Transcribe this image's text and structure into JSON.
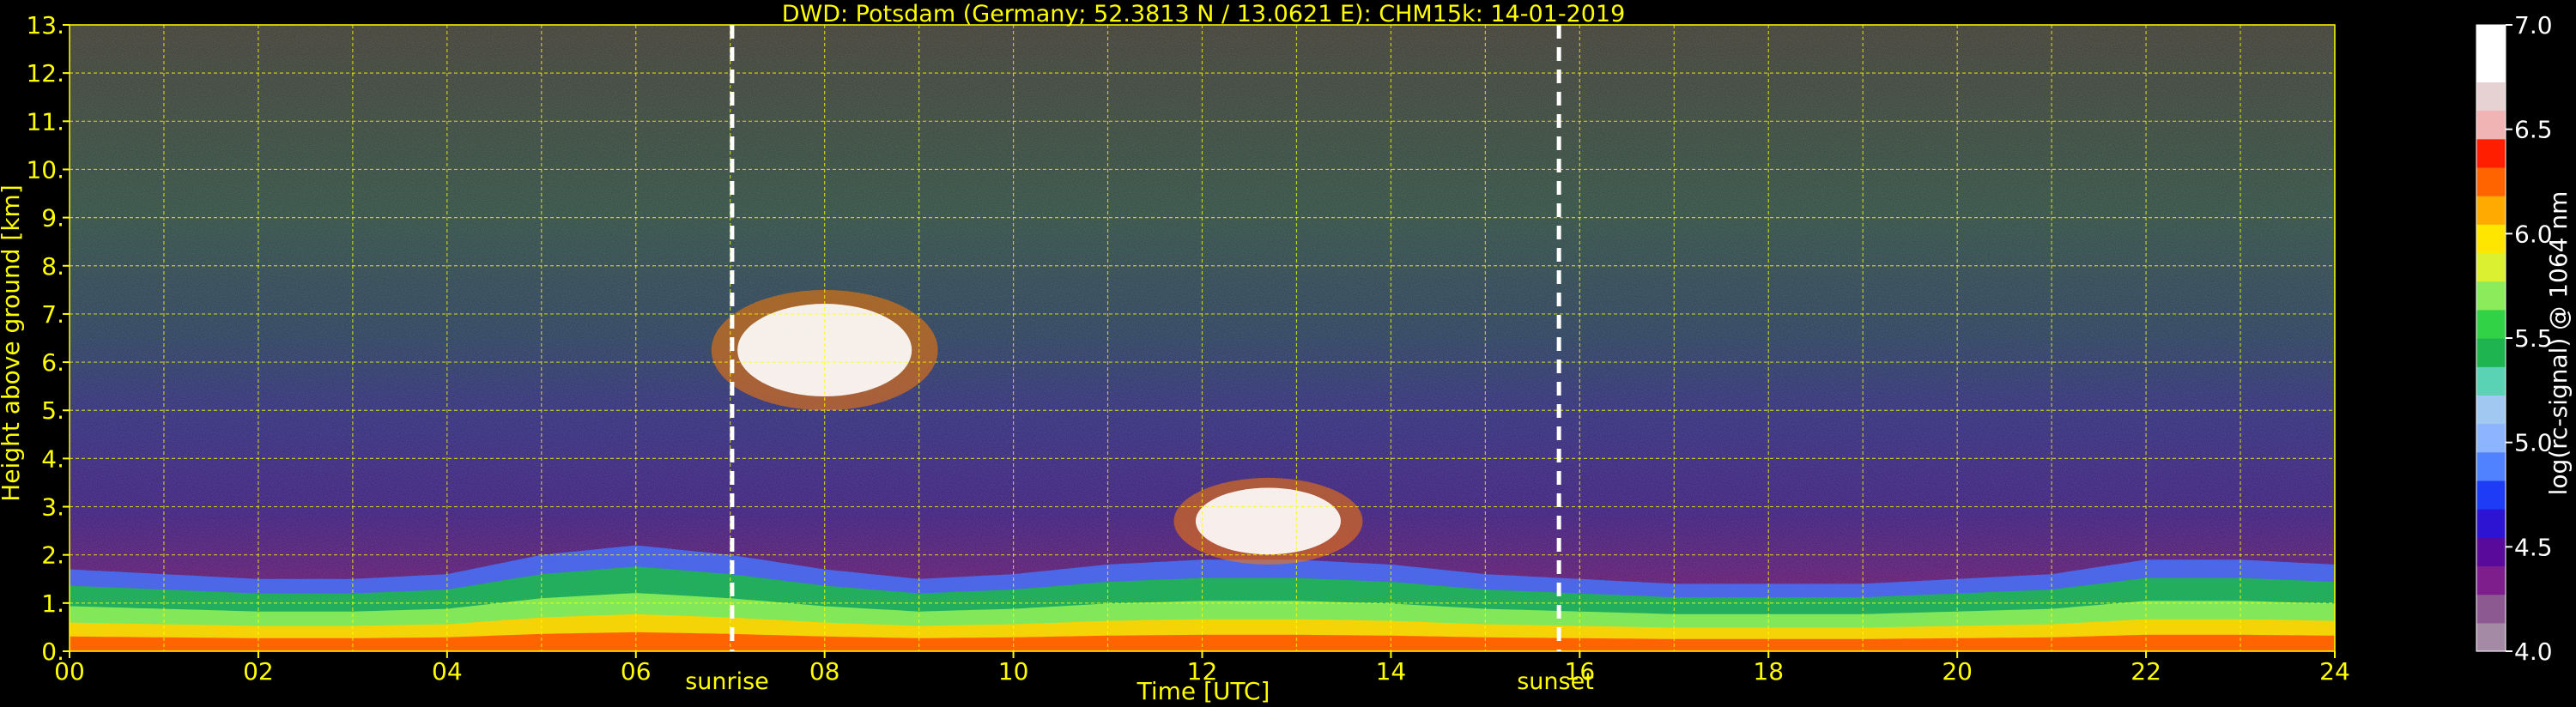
{
  "chart_data": {
    "type": "heatmap",
    "title": "DWD: Potsdam (Germany; 52.3813 N / 13.0621 E):    CHM15k: 14-01-2019",
    "xlabel": "Time [UTC]",
    "ylabel": "Height above ground [km]",
    "xlim": [
      0,
      24
    ],
    "ylim": [
      0,
      13
    ],
    "x_ticks": [
      "00",
      "02",
      "04",
      "06",
      "08",
      "10",
      "12",
      "14",
      "16",
      "18",
      "20",
      "22",
      "24"
    ],
    "y_ticks": [
      "0.",
      "1.",
      "2.",
      "3.",
      "4.",
      "5.",
      "6.",
      "7.",
      "8.",
      "9.",
      "10.",
      "11.",
      "12.",
      "13."
    ],
    "grid": true,
    "colorbar": {
      "label": "log(rc-signal) @ 1064 nm",
      "range": [
        4.0,
        7.0
      ],
      "ticks": [
        "4.0",
        "4.5",
        "5.0",
        "5.5",
        "6.0",
        "6.5",
        "7.0"
      ],
      "colors": [
        "#a58aa5",
        "#8c5a91",
        "#7d1e8c",
        "#5a0a9b",
        "#2d14d2",
        "#1e3cf5",
        "#5082ff",
        "#8cb4ff",
        "#a0c8f0",
        "#5ad2b4",
        "#1eb450",
        "#32d246",
        "#8ceb5a",
        "#dcf032",
        "#ffe600",
        "#ffaa00",
        "#ff6400",
        "#ff1e00",
        "#f0b4b4",
        "#e6d2d2",
        "#ffffff",
        "#ffffff"
      ]
    },
    "annotations": [
      {
        "label": "sunrise",
        "x": 7.02
      },
      {
        "label": "sunset",
        "x": 15.78
      }
    ],
    "boundary_layer": {
      "x": [
        0,
        1,
        2,
        3,
        4,
        5,
        6,
        7,
        8,
        9,
        10,
        11,
        12,
        13,
        14,
        15,
        16,
        17,
        18,
        19,
        20,
        21,
        22,
        23,
        24
      ],
      "top_km": [
        1.7,
        1.6,
        1.5,
        1.5,
        1.6,
        2.0,
        2.2,
        2.0,
        1.7,
        1.5,
        1.6,
        1.8,
        1.9,
        1.9,
        1.8,
        1.6,
        1.5,
        1.4,
        1.4,
        1.4,
        1.5,
        1.6,
        1.9,
        1.9,
        1.8
      ]
    },
    "clouds": [
      {
        "x_start": 6.8,
        "x_end": 9.2,
        "base_km": 5.0,
        "top_km": 7.5
      },
      {
        "x_start": 11.7,
        "x_end": 13.7,
        "base_km": 1.8,
        "top_km": 3.6
      }
    ]
  }
}
